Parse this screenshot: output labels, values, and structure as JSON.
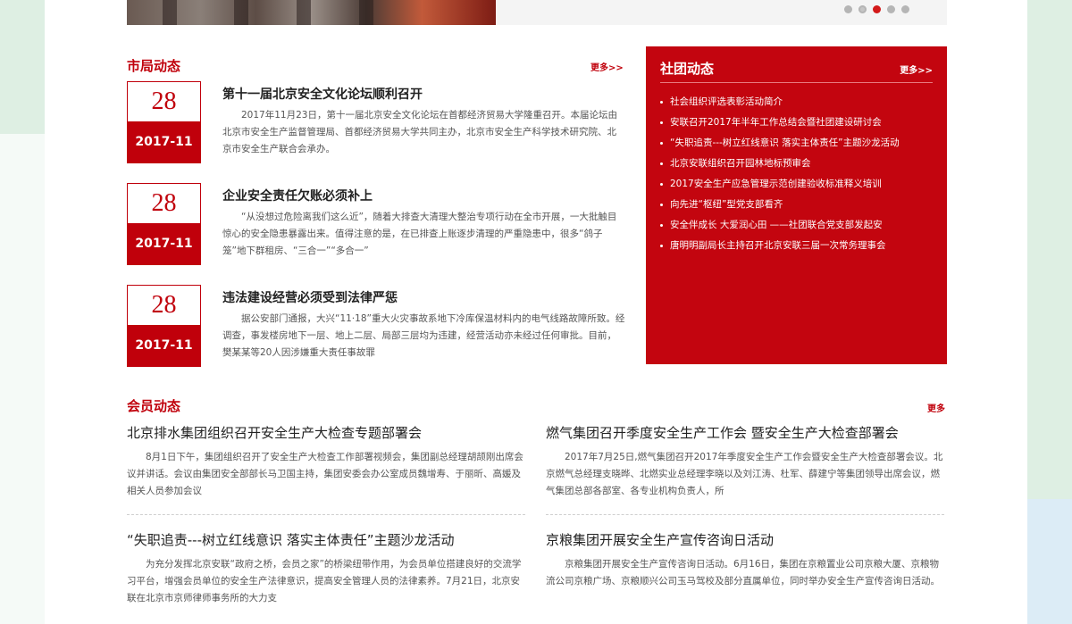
{
  "banner": {
    "dots": 5,
    "active_dot": 3
  },
  "city_news": {
    "title": "市局动态",
    "more": "更多>>",
    "items": [
      {
        "day": "28",
        "ym": "2017-11",
        "title": "第十一届北京安全文化论坛顺利召开",
        "desc": "2017年11月23日，第十一届北京安全文化论坛在首都经济贸易大学隆重召开。本届论坛由北京市安全生产监督管理局、首都经济贸易大学共同主办，北京市安全生产科学技术研究院、北京市安全生产联合会承办。"
      },
      {
        "day": "28",
        "ym": "2017-11",
        "title": "企业安全责任欠账必须补上",
        "desc": "“从没想过危险离我们这么近”，随着大排查大清理大整治专项行动在全市开展，一大批触目惊心的安全隐患暴露出来。值得注意的是，在已排查上账逐步清理的严重隐患中，很多“鸽子笼”地下群租房、“三合一”“多合一”"
      },
      {
        "day": "28",
        "ym": "2017-11",
        "title": "违法建设经营必须受到法律严惩",
        "desc": "据公安部门通报，大兴“11·18”重大火灾事故系地下冷库保温材料内的电气线路故障所致。经调查，事发楼房地下一层、地上二层、局部三层均为违建，经营活动亦未经过任何审批。目前，樊某某等20人因涉嫌重大责任事故罪"
      }
    ]
  },
  "association": {
    "title": "社团动态",
    "more": "更多>>",
    "items": [
      "社会组织评选表彰活动简介",
      "安联召开2017年半年工作总结会暨社团建设研讨会",
      "“失职追责---树立红线意识 落实主体责任”主题沙龙活动",
      "北京安联组织召开园林地标预审会",
      "2017安全生产应急管理示范创建验收标准释义培训",
      "向先进“枢纽”型党支部看齐",
      "安全伴成长 大爱润心田 ——社团联合党支部发起安",
      "唐明明副局长主持召开北京安联三届一次常务理事会"
    ]
  },
  "member_news": {
    "title": "会员动态",
    "more": "更多",
    "items": [
      {
        "title": "北京排水集团组织召开安全生产大检查专题部署会",
        "desc": "8月1日下午，集团组织召开了安全生产大检查工作部署视频会，集团副总经理胡颉刚出席会议并讲话。会议由集团安全部部长马卫国主持，集团安委会办公室成员魏增寿、于丽昕、高媛及相关人员参加会议"
      },
      {
        "title": "燃气集团召开季度安全生产工作会 暨安全生产大检查部署会",
        "desc": "2017年7月25日,燃气集团召开2017年季度安全生产工作会暨安全生产大检查部署会议。北京燃气总经理支晓晔、北燃实业总经理李晓以及刘江涛、杜军、薛建宁等集团领导出席会议，燃气集团总部各部室、各专业机构负责人，所"
      },
      {
        "title": "“失职追责---树立红线意识 落实主体责任”主题沙龙活动",
        "desc": "为充分发挥北京安联“政府之桥，会员之家”的桥梁纽带作用，为会员单位搭建良好的交流学习平台，增强会员单位的安全生产法律意识，提高安全管理人员的法律素养。7月21日，北京安联在北京市京师律师事务所的大力支"
      },
      {
        "title": "京粮集团开展安全生产宣传咨询日活动",
        "desc": "京粮集团开展安全生产宣传咨询日活动。6月16日，集团在京粮置业公司京粮大厦、京粮物流公司京粮广场、京粮顺兴公司玉马驾校及部分直属单位，同时举办安全生产宣传咨询日活动。"
      }
    ]
  }
}
